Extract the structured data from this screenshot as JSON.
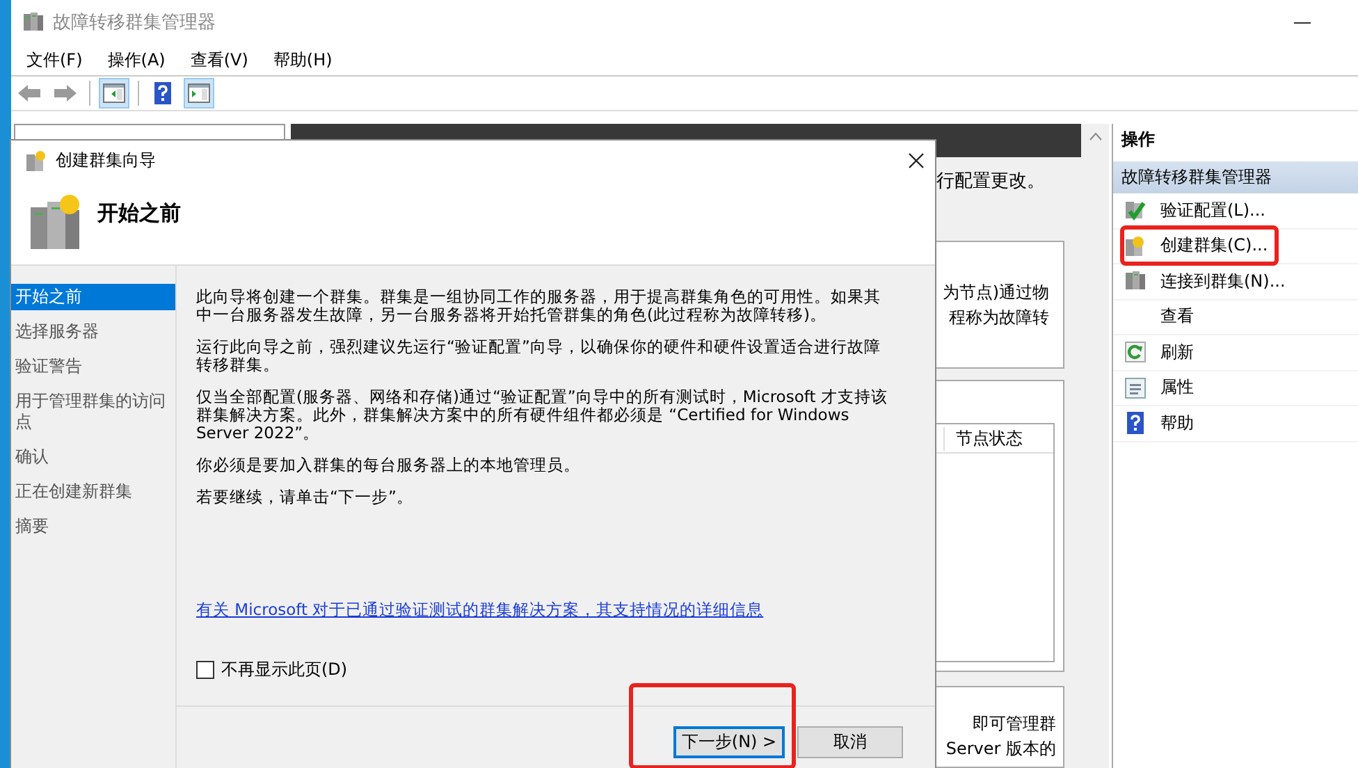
{
  "window": {
    "title": "故障转移群集管理器"
  },
  "menu": [
    "文件(F)",
    "操作(A)",
    "查看(V)",
    "帮助(H)"
  ],
  "toolbar": [
    {
      "kind": "back"
    },
    {
      "kind": "forward"
    },
    {
      "kind": "sep"
    },
    {
      "kind": "tree-toggle",
      "pressed": true
    },
    {
      "kind": "sep"
    },
    {
      "kind": "help",
      "pressed": false
    },
    {
      "kind": "actions-toggle",
      "pressed": true
    }
  ],
  "center": {
    "note": "行配置更改。",
    "panels": [
      {
        "kind": "text",
        "lines": [
          "为节点)通过物",
          "程称为故障转"
        ]
      },
      {
        "kind": "table",
        "columns": [
          "节点状态"
        ]
      },
      {
        "kind": "text",
        "lines": [
          "即可管理群",
          "Server 版本的"
        ]
      }
    ]
  },
  "actions": {
    "title": "操作",
    "section": "故障转移群集管理器",
    "items": [
      {
        "kind": "validate",
        "label": "验证配置(L)...",
        "highlighted": false
      },
      {
        "kind": "create",
        "label": "创建群集(C)...",
        "highlighted": true
      },
      {
        "kind": "connect",
        "label": "连接到群集(N)...",
        "highlighted": false
      },
      {
        "kind": "plain",
        "label": "查看",
        "highlighted": false
      },
      {
        "kind": "refresh",
        "label": "刷新",
        "highlighted": false
      },
      {
        "kind": "properties",
        "label": "属性",
        "highlighted": false
      },
      {
        "kind": "help",
        "label": "帮助",
        "highlighted": false
      }
    ]
  },
  "dialog": {
    "title": "创建群集向导",
    "heading": "开始之前",
    "steps": [
      {
        "label": "开始之前",
        "selected": true
      },
      {
        "label": "选择服务器",
        "selected": false
      },
      {
        "label": "验证警告",
        "selected": false
      },
      {
        "label": "用于管理群集的访问点",
        "selected": false
      },
      {
        "label": "确认",
        "selected": false
      },
      {
        "label": "正在创建新群集",
        "selected": false
      },
      {
        "label": "摘要",
        "selected": false
      }
    ],
    "paragraphs": [
      "此向导将创建一个群集。群集是一组协同工作的服务器，用于提高群集角色的可用性。如果其中一台服务器发生故障，另一台服务器将开始托管群集的角色(此过程称为故障转移)。",
      "运行此向导之前，强烈建议先运行“验证配置”向导，以确保你的硬件和硬件设置适合进行故障转移群集。",
      "仅当全部配置(服务器、网络和存储)通过“验证配置”向导中的所有测试时，Microsoft 才支持该群集解决方案。此外，群集解决方案中的所有硬件组件都必须是 “Certified for Windows Server 2022”。",
      "你必须是要加入群集的每台服务器上的本地管理员。",
      "若要继续，请单击“下一步”。"
    ],
    "link": "有关 Microsoft 对于已通过验证测试的群集解决方案，其支持情况的详细信息",
    "checkbox": {
      "label": "不再显示此页(D)",
      "checked": false
    },
    "buttons": [
      {
        "kind": "default",
        "label": "下一步(N) >",
        "highlighted": true
      },
      {
        "kind": "normal",
        "label": "取消",
        "highlighted": false
      }
    ]
  }
}
